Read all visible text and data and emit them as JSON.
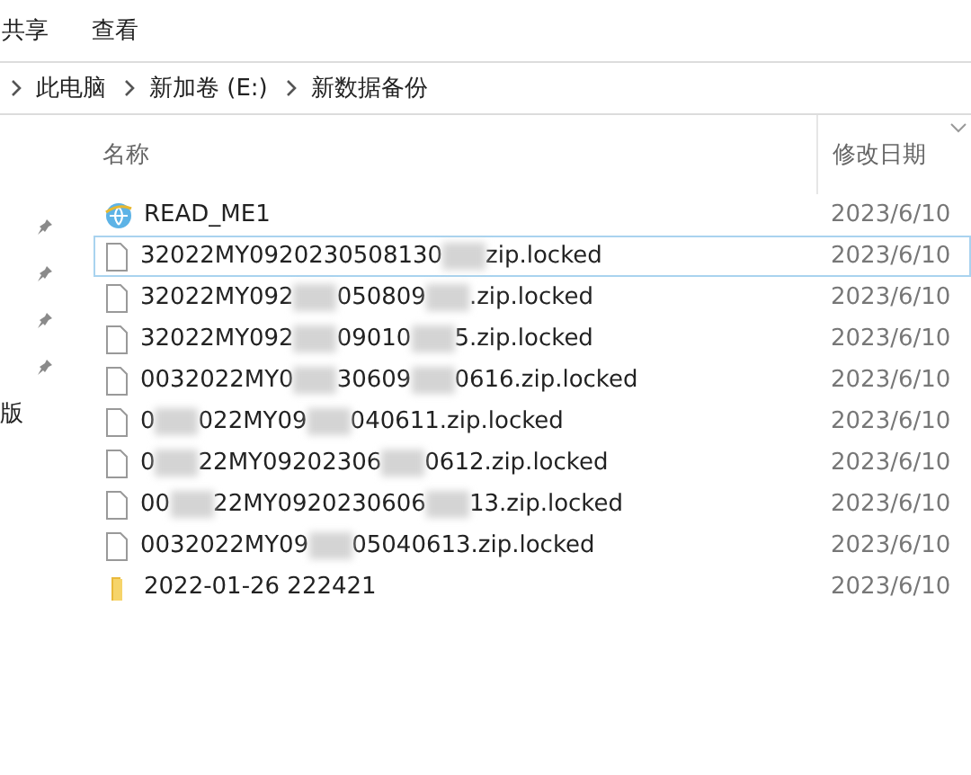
{
  "ribbon_tabs": [
    "共享",
    "查看"
  ],
  "address_bar": {
    "items": [
      "此电脑",
      "新加卷 (E:)",
      "新数据备份"
    ]
  },
  "nav_pane": {
    "quick_access": [
      {
        "pinned": true
      },
      {
        "pinned": true
      },
      {
        "pinned": true
      },
      {
        "pinned": true
      }
    ],
    "item_text": "版"
  },
  "columns": {
    "name": "名称",
    "modified": "修改日期"
  },
  "files": [
    {
      "kind": "web",
      "name_parts": [
        "READ_ME1"
      ],
      "modified": "2023/6/10",
      "hovered": false
    },
    {
      "kind": "file",
      "name_parts": [
        "32022MY0920230508130",
        "zip.locked"
      ],
      "modified": "2023/6/10",
      "hovered": true
    },
    {
      "kind": "file",
      "name_parts": [
        "32022MY092",
        "050809",
        ".zip.locked"
      ],
      "modified": "2023/6/10",
      "hovered": false
    },
    {
      "kind": "file",
      "name_parts": [
        "32022MY092",
        "09010",
        "5.zip.locked"
      ],
      "modified": "2023/6/10",
      "hovered": false
    },
    {
      "kind": "file",
      "name_parts": [
        "0032022MY0",
        "30609",
        "0616.zip.locked"
      ],
      "modified": "2023/6/10",
      "hovered": false
    },
    {
      "kind": "file",
      "name_parts": [
        "0",
        "022MY09",
        "040611.zip.locked"
      ],
      "modified": "2023/6/10",
      "hovered": false
    },
    {
      "kind": "file",
      "name_parts": [
        "0",
        "22MY09202306",
        "0612.zip.locked"
      ],
      "modified": "2023/6/10",
      "hovered": false
    },
    {
      "kind": "file",
      "name_parts": [
        "00",
        "22MY0920230606",
        "13.zip.locked"
      ],
      "modified": "2023/6/10",
      "hovered": false
    },
    {
      "kind": "file",
      "name_parts": [
        "0032022MY09",
        "05040613.zip.locked"
      ],
      "modified": "2023/6/10",
      "hovered": false
    },
    {
      "kind": "folder",
      "name_parts": [
        "2022-01-26 222421"
      ],
      "modified": "2023/6/10",
      "hovered": false
    }
  ]
}
